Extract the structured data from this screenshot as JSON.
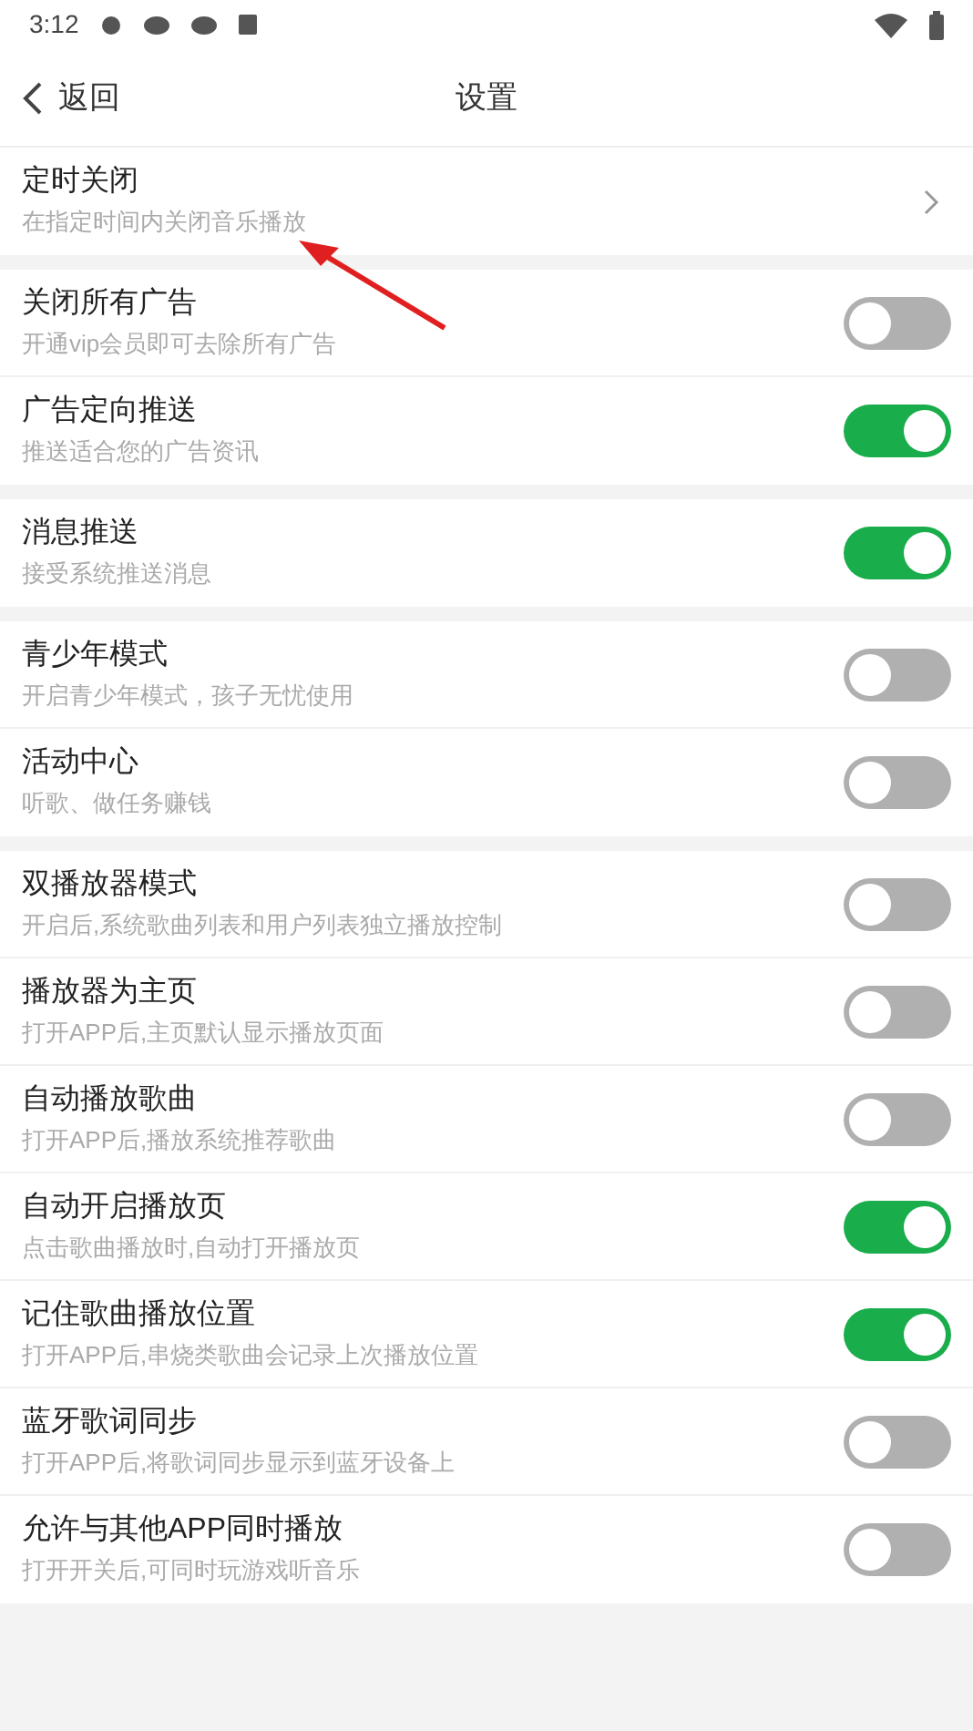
{
  "status_bar": {
    "time": "3:12"
  },
  "header": {
    "back": "返回",
    "title": "设置"
  },
  "sections": [
    {
      "rows": [
        {
          "kind": "link",
          "title": "定时关闭",
          "subtitle": "在指定时间内关闭音乐播放"
        }
      ]
    },
    {
      "rows": [
        {
          "kind": "switch",
          "title": "关闭所有广告",
          "subtitle": "开通vip会员即可去除所有广告",
          "on": false
        },
        {
          "kind": "switch",
          "title": "广告定向推送",
          "subtitle": "推送适合您的广告资讯",
          "on": true
        }
      ]
    },
    {
      "rows": [
        {
          "kind": "switch",
          "title": "消息推送",
          "subtitle": "接受系统推送消息",
          "on": true
        }
      ]
    },
    {
      "rows": [
        {
          "kind": "switch",
          "title": "青少年模式",
          "subtitle": "开启青少年模式，孩子无忧使用",
          "on": false
        },
        {
          "kind": "switch",
          "title": "活动中心",
          "subtitle": "听歌、做任务赚钱",
          "on": false
        }
      ]
    },
    {
      "rows": [
        {
          "kind": "switch",
          "title": "双播放器模式",
          "subtitle": "开启后,系统歌曲列表和用户列表独立播放控制",
          "on": false
        },
        {
          "kind": "switch",
          "title": "播放器为主页",
          "subtitle": "打开APP后,主页默认显示播放页面",
          "on": false
        },
        {
          "kind": "switch",
          "title": "自动播放歌曲",
          "subtitle": "打开APP后,播放系统推荐歌曲",
          "on": false
        },
        {
          "kind": "switch",
          "title": "自动开启播放页",
          "subtitle": "点击歌曲播放时,自动打开播放页",
          "on": true
        },
        {
          "kind": "switch",
          "title": "记住歌曲播放位置",
          "subtitle": "打开APP后,串烧类歌曲会记录上次播放位置",
          "on": true
        },
        {
          "kind": "switch",
          "title": "蓝牙歌词同步",
          "subtitle": "打开APP后,将歌词同步显示到蓝牙设备上",
          "on": false
        },
        {
          "kind": "switch",
          "title": "允许与其他APP同时播放",
          "subtitle": "打开开关后,可同时玩游戏听音乐",
          "on": false
        }
      ]
    }
  ]
}
